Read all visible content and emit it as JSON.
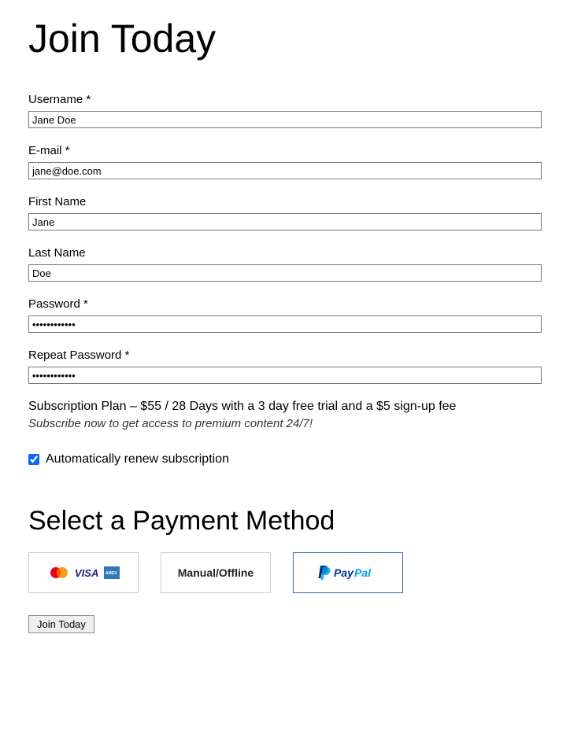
{
  "page_title": "Join Today",
  "fields": {
    "username": {
      "label": "Username *",
      "value": "Jane Doe"
    },
    "email": {
      "label": "E-mail *",
      "value": "jane@doe.com"
    },
    "first_name": {
      "label": "First Name",
      "value": "Jane"
    },
    "last_name": {
      "label": "Last Name",
      "value": "Doe"
    },
    "password": {
      "label": "Password *",
      "value": "••••••••••••"
    },
    "repeat_password": {
      "label": "Repeat Password *",
      "value": "••••••••••••"
    }
  },
  "plan_line": "Subscription Plan – $55 / 28 Days with a 3 day free trial and a $5 sign-up fee",
  "plan_desc": "Subscribe now to get access to premium content 24/7!",
  "auto_renew": {
    "label": "Automatically renew subscription",
    "checked": true
  },
  "payment_title": "Select a Payment Method",
  "payment_methods": {
    "creditcard": {
      "selected": false
    },
    "manual": {
      "label": "Manual/Offline",
      "selected": false
    },
    "paypal": {
      "selected": true
    }
  },
  "submit_label": "Join Today"
}
